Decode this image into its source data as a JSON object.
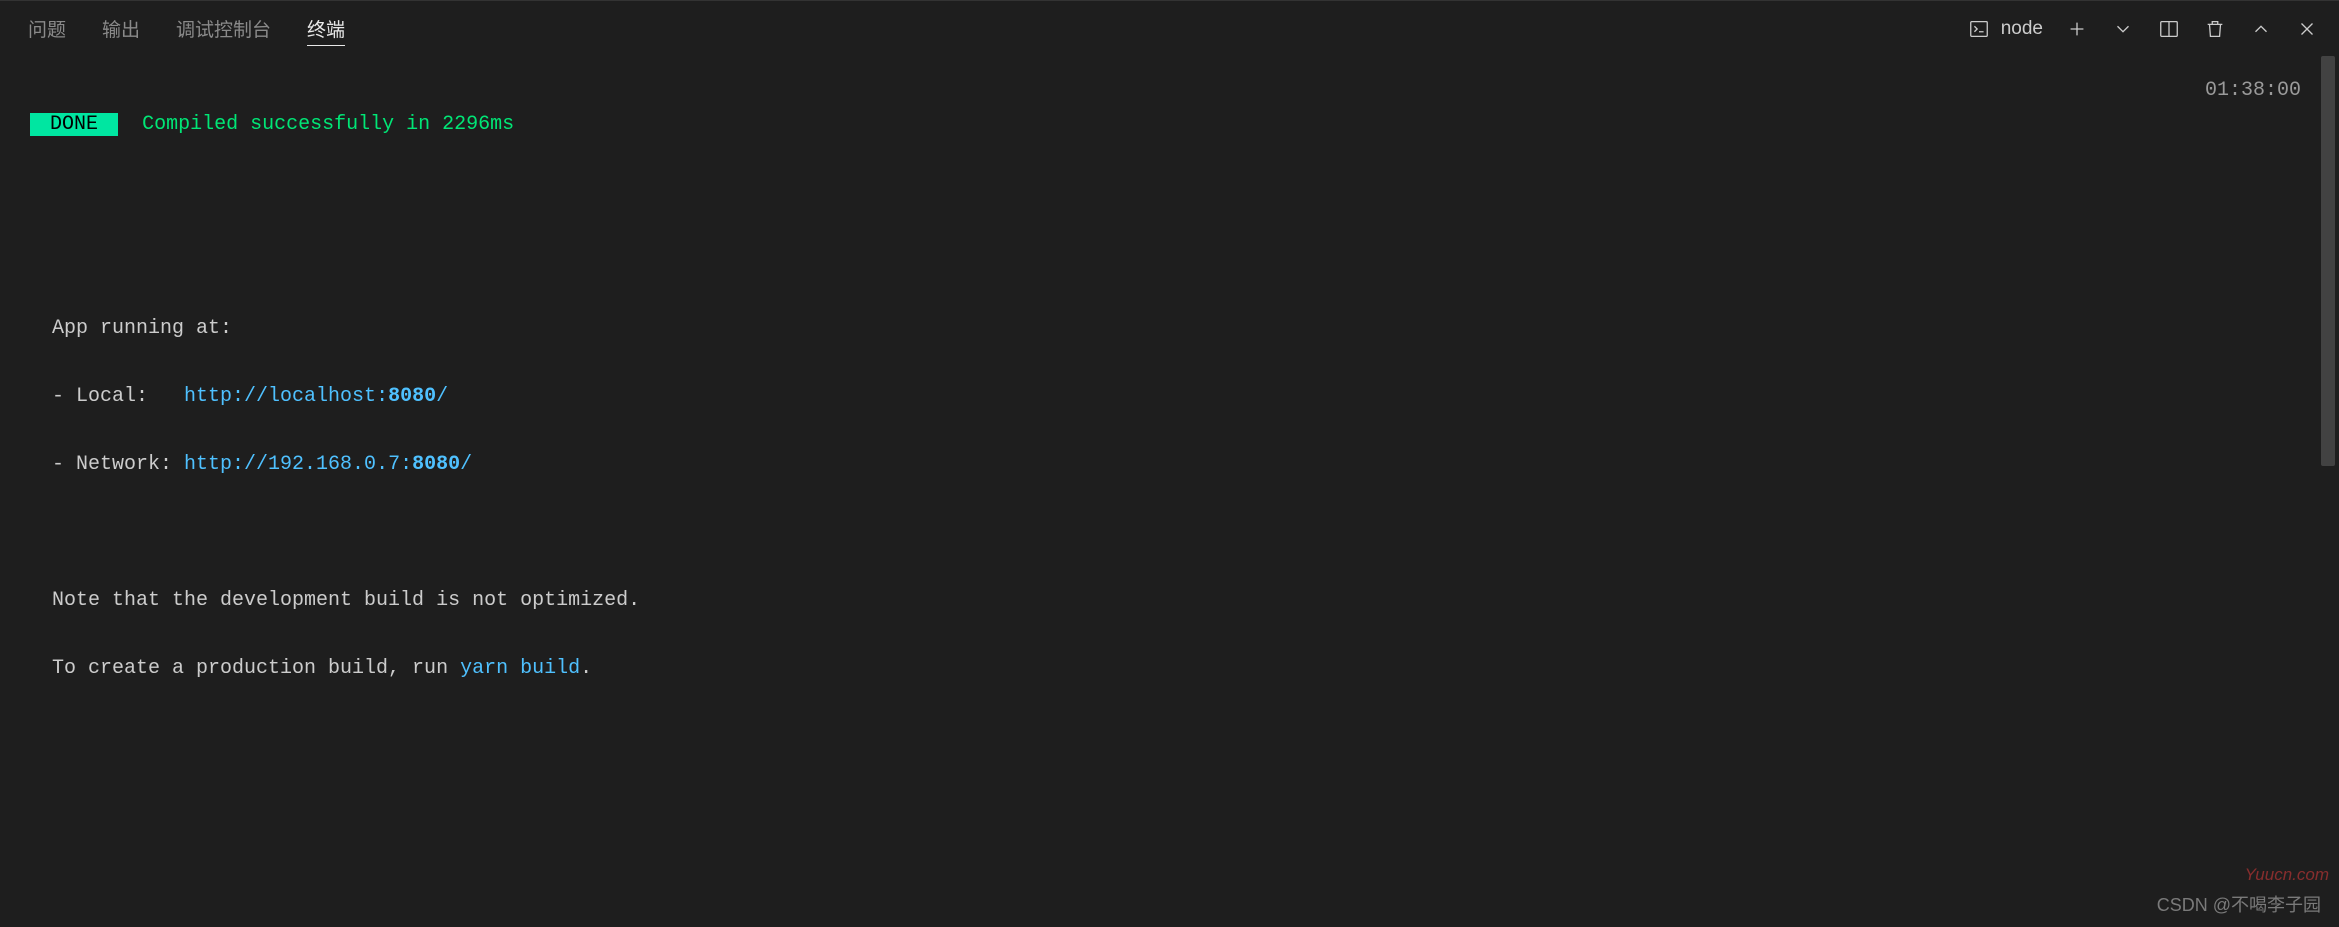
{
  "tabs": {
    "problems": "问题",
    "output": "输出",
    "debug": "调试控制台",
    "terminal": "终端"
  },
  "toolbar": {
    "shell_name": "node"
  },
  "terminal": {
    "done_label": "DONE",
    "compiled_msg": "Compiled successfully in 2296ms",
    "timestamp": "01:38:00",
    "app_running": "App running at:",
    "local_label": "- Local:   ",
    "local_url_prefix": "http://localhost:",
    "local_port": "8080",
    "local_url_suffix": "/",
    "network_label": "- Network: ",
    "network_url_prefix": "http://192.168.0.7:",
    "network_port": "8080",
    "network_url_suffix": "/",
    "note_line1": "Note that the development build is not optimized.",
    "note_line2_prefix": "To create a production build, run ",
    "note_line2_cmd": "yarn build",
    "note_line2_suffix": "."
  },
  "watermarks": {
    "csdn": "CSDN @不喝李子园",
    "red": "Yuucn.com"
  }
}
